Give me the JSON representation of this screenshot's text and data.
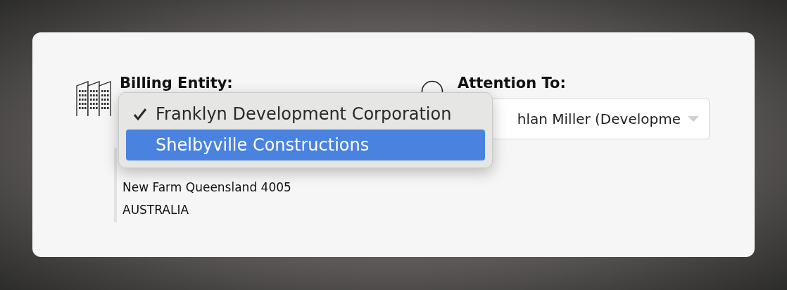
{
  "billing": {
    "label": "Billing Entity:",
    "address_lines": [
      "New Farm Queensland 4005",
      "AUSTRALIA"
    ]
  },
  "menu": {
    "options": [
      {
        "label": "Franklyn Development Corporation",
        "checked": true,
        "selected": false
      },
      {
        "label": "Shelbyville Constructions",
        "checked": false,
        "selected": true
      }
    ]
  },
  "attention": {
    "label": "Attention To:",
    "value": "hlan Miller (Developme"
  }
}
